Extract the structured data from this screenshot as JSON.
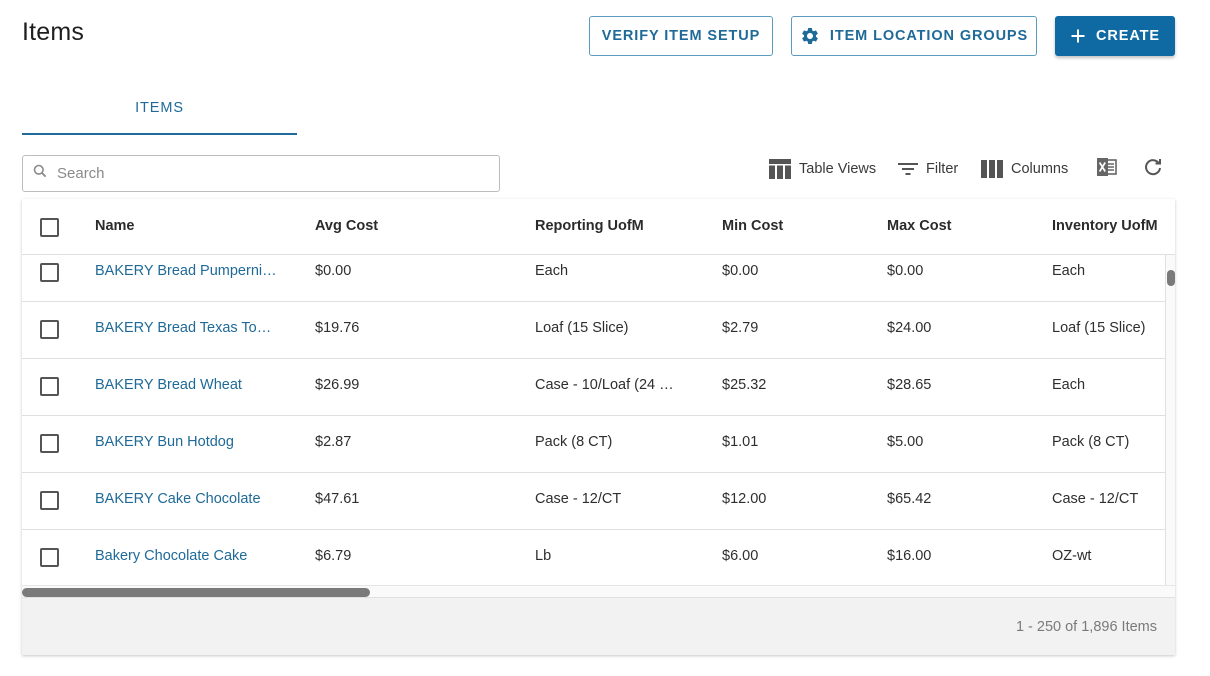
{
  "page": {
    "title": "Items"
  },
  "header": {
    "verify_label": "VERIFY ITEM SETUP",
    "groups_label": "ITEM LOCATION GROUPS",
    "create_label": "CREATE"
  },
  "tabs": [
    {
      "label": "ITEMS",
      "active": true
    }
  ],
  "search": {
    "placeholder": "Search",
    "value": ""
  },
  "toolbar": {
    "table_views": "Table Views",
    "filter": "Filter",
    "columns": "Columns",
    "export_icon": "excel-icon",
    "refresh_icon": "refresh-icon"
  },
  "table": {
    "columns": [
      "Name",
      "Avg Cost",
      "Reporting UofM",
      "Min Cost",
      "Max Cost",
      "Inventory UofM"
    ],
    "rows": [
      {
        "name": "BAKERY Bread Pumperni…",
        "avg_cost": "$0.00",
        "reporting_uofm": "Each",
        "min_cost": "$0.00",
        "max_cost": "$0.00",
        "inventory_uofm": "Each"
      },
      {
        "name": "BAKERY Bread Texas To…",
        "avg_cost": "$19.76",
        "reporting_uofm": "Loaf (15 Slice)",
        "min_cost": "$2.79",
        "max_cost": "$24.00",
        "inventory_uofm": "Loaf (15 Slice)"
      },
      {
        "name": "BAKERY Bread Wheat",
        "avg_cost": "$26.99",
        "reporting_uofm": "Case - 10/Loaf (24 …",
        "min_cost": "$25.32",
        "max_cost": "$28.65",
        "inventory_uofm": "Each"
      },
      {
        "name": "BAKERY Bun Hotdog",
        "avg_cost": "$2.87",
        "reporting_uofm": "Pack (8 CT)",
        "min_cost": "$1.01",
        "max_cost": "$5.00",
        "inventory_uofm": "Pack (8 CT)"
      },
      {
        "name": "BAKERY Cake Chocolate",
        "avg_cost": "$47.61",
        "reporting_uofm": "Case - 12/CT",
        "min_cost": "$12.00",
        "max_cost": "$65.42",
        "inventory_uofm": "Case - 12/CT"
      },
      {
        "name": "Bakery Chocolate Cake",
        "avg_cost": "$6.79",
        "reporting_uofm": "Lb",
        "min_cost": "$6.00",
        "max_cost": "$16.00",
        "inventory_uofm": "OZ-wt"
      }
    ]
  },
  "footer": {
    "pagination": "1 - 250 of 1,896 Items"
  },
  "colors": {
    "accent": "#1f6a98",
    "primary_button": "#0f6aa3",
    "link": "#1f6a98"
  }
}
